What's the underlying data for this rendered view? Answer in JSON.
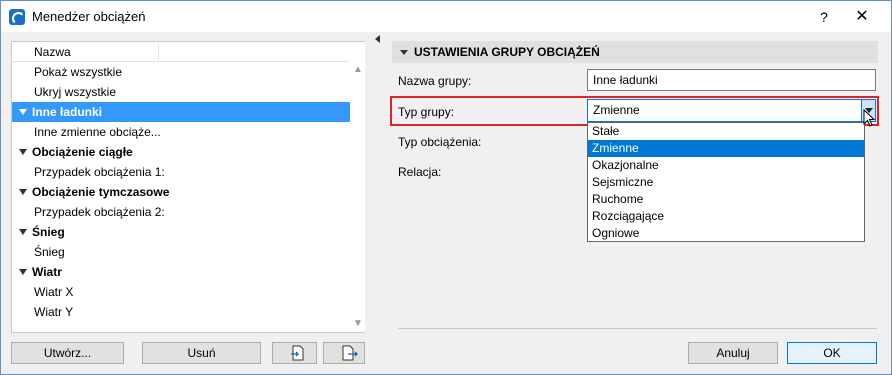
{
  "window": {
    "title": "Menedżer obciążeń",
    "help": "?",
    "close": "✕"
  },
  "list": {
    "header": "Nazwa",
    "rows": [
      {
        "type": "item",
        "label": "Pokaż wszystkie"
      },
      {
        "type": "item",
        "label": "Ukryj wszystkie"
      },
      {
        "type": "group",
        "label": "Inne ładunki",
        "selected": true
      },
      {
        "type": "item",
        "label": "Inne zmienne obciąże..."
      },
      {
        "type": "group",
        "label": "Obciążenie ciągłe"
      },
      {
        "type": "item",
        "label": "Przypadek obciążenia 1:"
      },
      {
        "type": "group",
        "label": "Obciążenie tymczasowe"
      },
      {
        "type": "item",
        "label": "Przypadek obciążenia 2:"
      },
      {
        "type": "group",
        "label": "Śnieg"
      },
      {
        "type": "item",
        "label": "Śnieg"
      },
      {
        "type": "group",
        "label": "Wiatr"
      },
      {
        "type": "item",
        "label": "Wiatr X"
      },
      {
        "type": "item",
        "label": "Wiatr Y"
      }
    ]
  },
  "buttons": {
    "create": "Utwórz...",
    "delete": "Usuń",
    "import_icon": "import-icon",
    "export_icon": "export-icon",
    "cancel": "Anuluj",
    "ok": "OK"
  },
  "settings": {
    "section_title": "USTAWIENIA GRUPY OBCIĄŻEŃ",
    "group_name_label": "Nazwa grupy:",
    "group_name_value": "Inne ładunki",
    "group_type_label": "Typ grupy:",
    "group_type_value": "Zmienne",
    "load_type_label": "Typ obciążenia:",
    "relation_label": "Relacja:",
    "options": [
      "Stałe",
      "Zmienne",
      "Okazjonalne",
      "Sejsmiczne",
      "Ruchome",
      "Rozciągające",
      "Ogniowe"
    ],
    "selected_option": "Zmienne"
  },
  "colors": {
    "selection": "#3399ff",
    "highlight": "#e0202a",
    "focus": "#0078d7"
  }
}
